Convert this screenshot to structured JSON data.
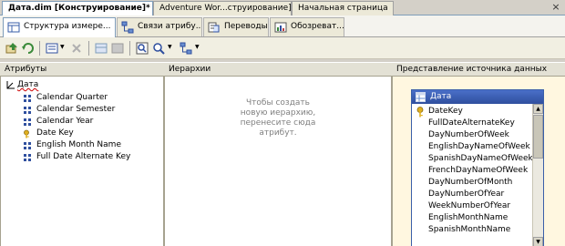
{
  "doc_tabs": [
    {
      "label": "Дата.dim [Конструирование]*",
      "active": true
    },
    {
      "label": "Adventure Wor...струирование]",
      "active": false
    },
    {
      "label": "Начальная страница",
      "active": false
    }
  ],
  "close_glyph": "×",
  "designer_tabs": [
    {
      "label": "Структура измере...",
      "icon": "dimension-structure-icon",
      "active": true
    },
    {
      "label": "Связи атрибу...",
      "icon": "attribute-relationships-icon",
      "active": false
    },
    {
      "label": "Переводы",
      "icon": "translations-icon",
      "active": false
    },
    {
      "label": "Обозреват...",
      "icon": "browser-icon",
      "active": false
    }
  ],
  "panels": {
    "attributes_header": "Атрибуты",
    "hierarchies_header": "Иерархии",
    "dsv_header": "Представление источника данных"
  },
  "attributes": {
    "root": "Дата",
    "items": [
      {
        "label": "Calendar Quarter",
        "icon": "attribute-icon"
      },
      {
        "label": "Calendar Semester",
        "icon": "attribute-icon"
      },
      {
        "label": "Calendar Year",
        "icon": "attribute-icon"
      },
      {
        "label": "Date Key",
        "icon": "key-attribute-icon"
      },
      {
        "label": "English Month Name",
        "icon": "attribute-icon"
      },
      {
        "label": "Full Date Alternate Key",
        "icon": "attribute-icon"
      }
    ]
  },
  "hierarchies": {
    "hint_lines": [
      "Чтобы создать",
      "новую иерархию,",
      "перенесите сюда",
      "атрибут."
    ]
  },
  "dsv_table": {
    "title": "Дата",
    "columns": [
      {
        "label": "DateKey",
        "key": true
      },
      {
        "label": "FullDateAlternateKey",
        "key": false
      },
      {
        "label": "DayNumberOfWeek",
        "key": false
      },
      {
        "label": "EnglishDayNameOfWeek",
        "key": false
      },
      {
        "label": "SpanishDayNameOfWeek",
        "key": false
      },
      {
        "label": "FrenchDayNameOfWeek",
        "key": false
      },
      {
        "label": "DayNumberOfMonth",
        "key": false
      },
      {
        "label": "DayNumberOfYear",
        "key": false
      },
      {
        "label": "WeekNumberOfYear",
        "key": false
      },
      {
        "label": "EnglishMonthName",
        "key": false
      },
      {
        "label": "SpanishMonthName",
        "key": false
      }
    ]
  },
  "colors": {
    "accent": "#2f4f9e",
    "panel_bg": "#fff7e0"
  }
}
